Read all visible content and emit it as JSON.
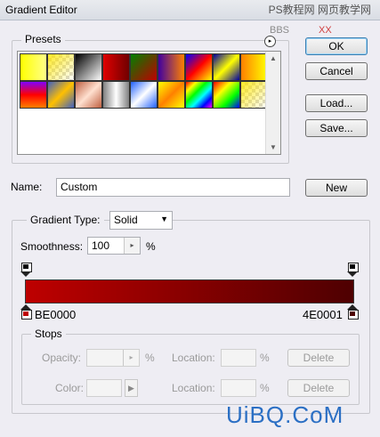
{
  "window": {
    "title": "Gradient Editor"
  },
  "watermark": {
    "top_text": "PS教程网 网页教学网",
    "top_sub": "BBS",
    "close_mark": "XX",
    "bottom_text": "UiBQ.CoM"
  },
  "presets": {
    "legend": "Presets",
    "swatches_row1": [
      "linear-gradient(90deg,#ffff00,#ffff88)",
      "checker-yellow",
      "linear-gradient(135deg,#000,#fff)",
      "linear-gradient(90deg,#e00000,#700000)",
      "linear-gradient(135deg,#008000,#c00000)",
      "linear-gradient(90deg,#4000a0,#ff8000)",
      "linear-gradient(135deg,#0000ff,#ff0000,#ffff00)",
      "linear-gradient(135deg,#0000a0,#ffff00,#0000a0)",
      "linear-gradient(90deg,#ff8000,#ffff00)"
    ],
    "swatches_row2": [
      "linear-gradient(180deg,#8000ff,#ff0000,#ff8000)",
      "linear-gradient(135deg,#4060c0,#ffc000,#4060c0)",
      "linear-gradient(135deg,#c06040,#ffe0d0,#c06040)",
      "linear-gradient(90deg,#808080,#fff,#808080)",
      "linear-gradient(135deg,#2060ff,#fff,#2060ff)",
      "linear-gradient(135deg,#ffff00,#ff8000,#ffff00)",
      "linear-gradient(135deg,#ff0000,#ffff00,#00ff00,#00ffff,#0000ff,#ff00ff)",
      "linear-gradient(135deg,#ff0000,#ffff00,#00ff00,#0000ff)",
      "checker-yellow"
    ]
  },
  "buttons": {
    "ok": "OK",
    "cancel": "Cancel",
    "load": "Load...",
    "save": "Save...",
    "new": "New"
  },
  "name_row": {
    "label": "Name:",
    "value": "Custom"
  },
  "gradient": {
    "type_label": "Gradient Type:",
    "type_value": "Solid",
    "smoothness_label": "Smoothness:",
    "smoothness_value": "100",
    "smoothness_unit": "%",
    "start_color": "#BE0000",
    "end_color": "#4E0001",
    "start_label": "BE0000",
    "end_label": "4E0001"
  },
  "stops": {
    "legend": "Stops",
    "opacity_label": "Opacity:",
    "opacity_unit": "%",
    "location_label": "Location:",
    "location_unit": "%",
    "color_label": "Color:",
    "delete_label": "Delete"
  }
}
